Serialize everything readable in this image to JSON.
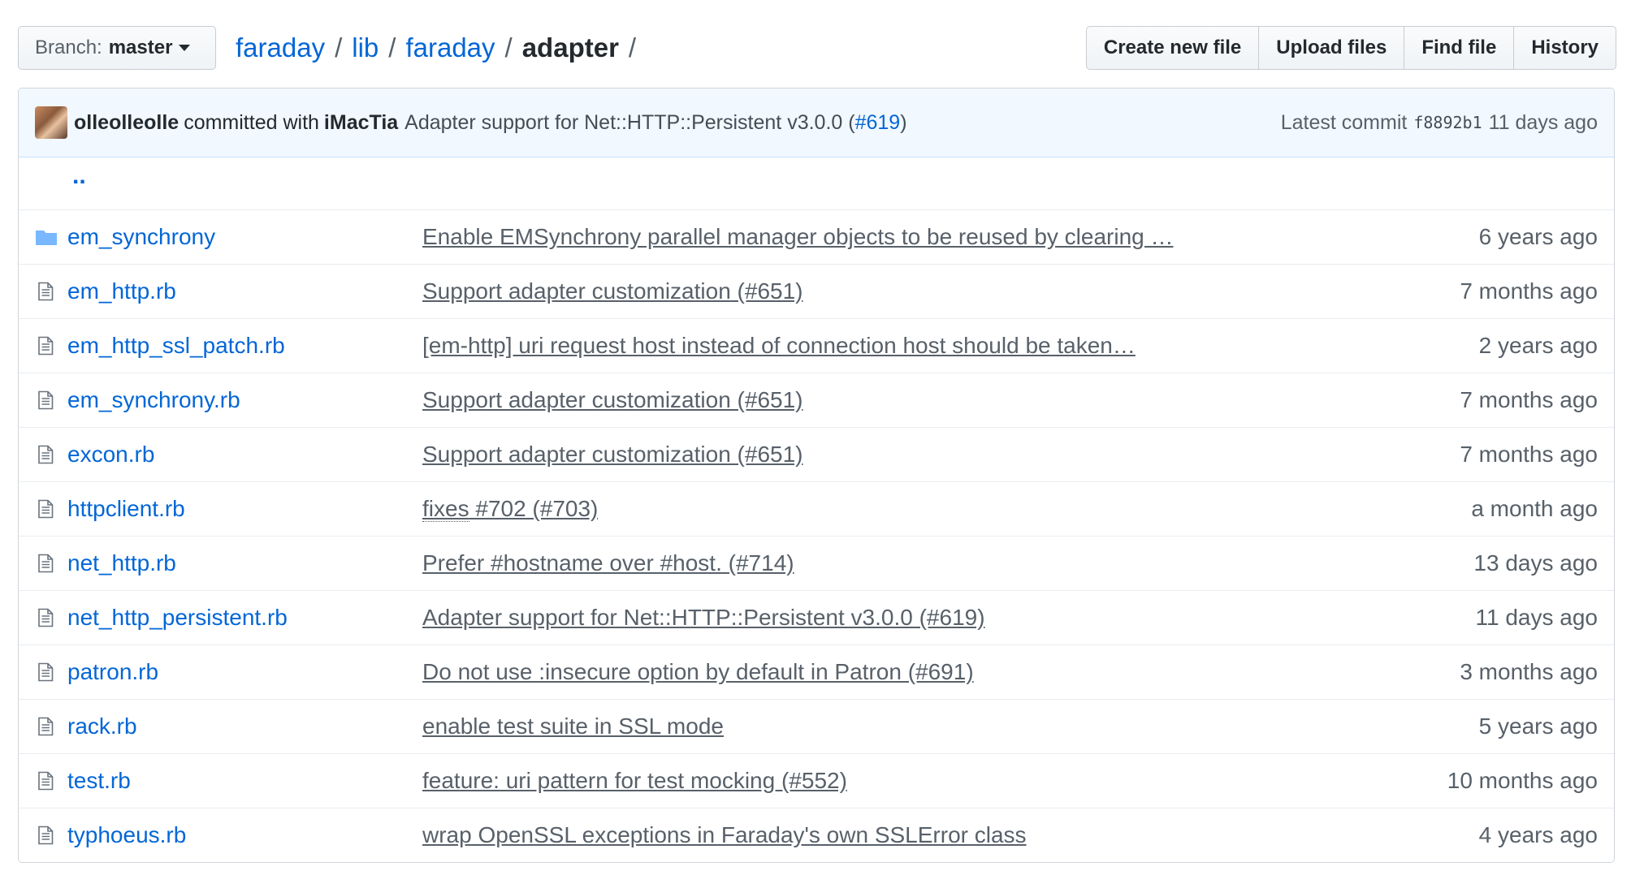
{
  "branch": {
    "label": "Branch:",
    "value": "master"
  },
  "breadcrumb": {
    "parts": [
      "faraday",
      "lib",
      "faraday"
    ],
    "separator": "/",
    "current": "adapter",
    "trailing": "/"
  },
  "actions": {
    "create_new_file": "Create new file",
    "upload_files": "Upload files",
    "find_file": "Find file",
    "history": "History"
  },
  "commit": {
    "author": "olleolleolle",
    "committed_with": "committed with",
    "coauthor": "iMacTia",
    "message": "Adapter support for Net::HTTP::Persistent v3.0.0 (",
    "pr": "#619",
    "message_end": ")",
    "latest_label": "Latest commit",
    "sha": "f8892b1",
    "age": "11 days ago"
  },
  "parent_dir": "..",
  "files": [
    {
      "icon": "folder-icon",
      "name": "em_synchrony",
      "message": "Enable EMSynchrony parallel manager objects to be reused by clearing …",
      "age": "6 years ago"
    },
    {
      "icon": "file-icon",
      "name": "em_http.rb",
      "message": "Support adapter customization (#651)",
      "age": "7 months ago"
    },
    {
      "icon": "file-icon",
      "name": "em_http_ssl_patch.rb",
      "message": "[em-http] uri request host instead of connection host should be taken…",
      "age": "2 years ago"
    },
    {
      "icon": "file-icon",
      "name": "em_synchrony.rb",
      "message": "Support adapter customization (#651)",
      "age": "7 months ago"
    },
    {
      "icon": "file-icon",
      "name": "excon.rb",
      "message": "Support adapter customization (#651)",
      "age": "7 months ago"
    },
    {
      "icon": "file-icon",
      "name": "httpclient.rb",
      "message_dotted": "fixes",
      "message": " #702 (#703)",
      "age": "a month ago"
    },
    {
      "icon": "file-icon",
      "name": "net_http.rb",
      "message": "Prefer #hostname over #host. (#714)",
      "age": "13 days ago"
    },
    {
      "icon": "file-icon",
      "name": "net_http_persistent.rb",
      "message": "Adapter support for Net::HTTP::Persistent v3.0.0 (#619)",
      "age": "11 days ago"
    },
    {
      "icon": "file-icon",
      "name": "patron.rb",
      "message": "Do not use :insecure option by default in Patron (#691)",
      "age": "3 months ago"
    },
    {
      "icon": "file-icon",
      "name": "rack.rb",
      "message": "enable test suite in SSL mode",
      "age": "5 years ago"
    },
    {
      "icon": "file-icon",
      "name": "test.rb",
      "message": "feature: uri pattern for test mocking (#552)",
      "age": "10 months ago"
    },
    {
      "icon": "file-icon",
      "name": "typhoeus.rb",
      "message": "wrap OpenSSL exceptions in Faraday's own SSLError class",
      "age": "4 years ago"
    }
  ],
  "colors": {
    "link": "#0366d6",
    "muted": "#586069",
    "commit_bg": "#f1f8ff",
    "folder": "#79b8ff"
  }
}
